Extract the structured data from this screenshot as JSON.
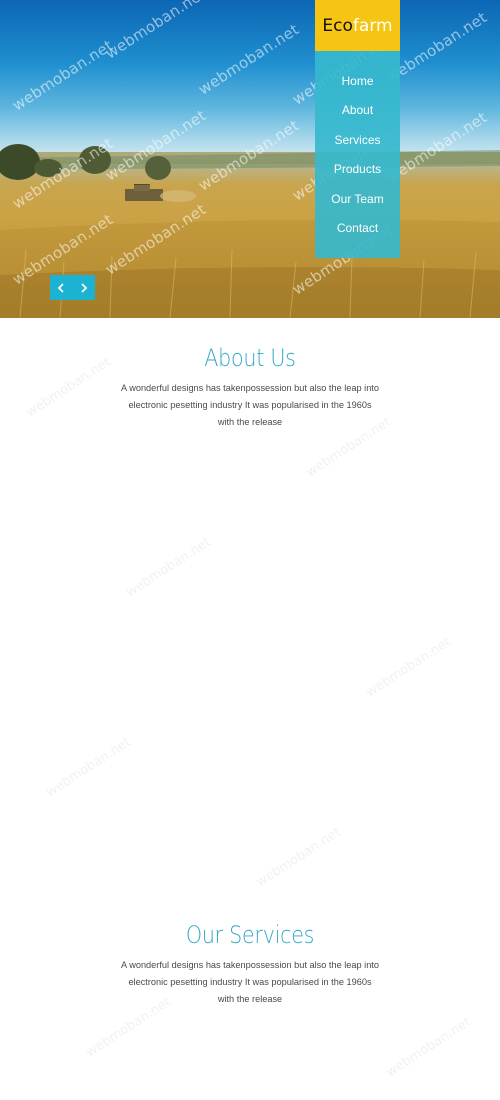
{
  "brand": {
    "part1": "Eco",
    "part2": "farm"
  },
  "nav": {
    "items": [
      {
        "label": "Home"
      },
      {
        "label": "About"
      },
      {
        "label": "Services"
      },
      {
        "label": "Products"
      },
      {
        "label": "Our Team"
      },
      {
        "label": "Contact"
      }
    ]
  },
  "watermark": "webmoban.net",
  "slider": {
    "prev_icon": "chevron-left-icon",
    "next_icon": "chevron-right-icon"
  },
  "about": {
    "title": "About Us",
    "text": "A wonderful designs has takenpossession but also the leap into electronic pesetting industry It was popularised in the 1960s with the release"
  },
  "services": {
    "title": "Our Services",
    "text": "A wonderful designs has takenpossession but also the leap into electronic pesetting industry It was popularised in the 1960s with the release"
  },
  "colors": {
    "brand_bg": "#f6c412",
    "nav_bg": "#36b8cd",
    "accent": "#1bb3d1",
    "title": "#32a8c4"
  }
}
